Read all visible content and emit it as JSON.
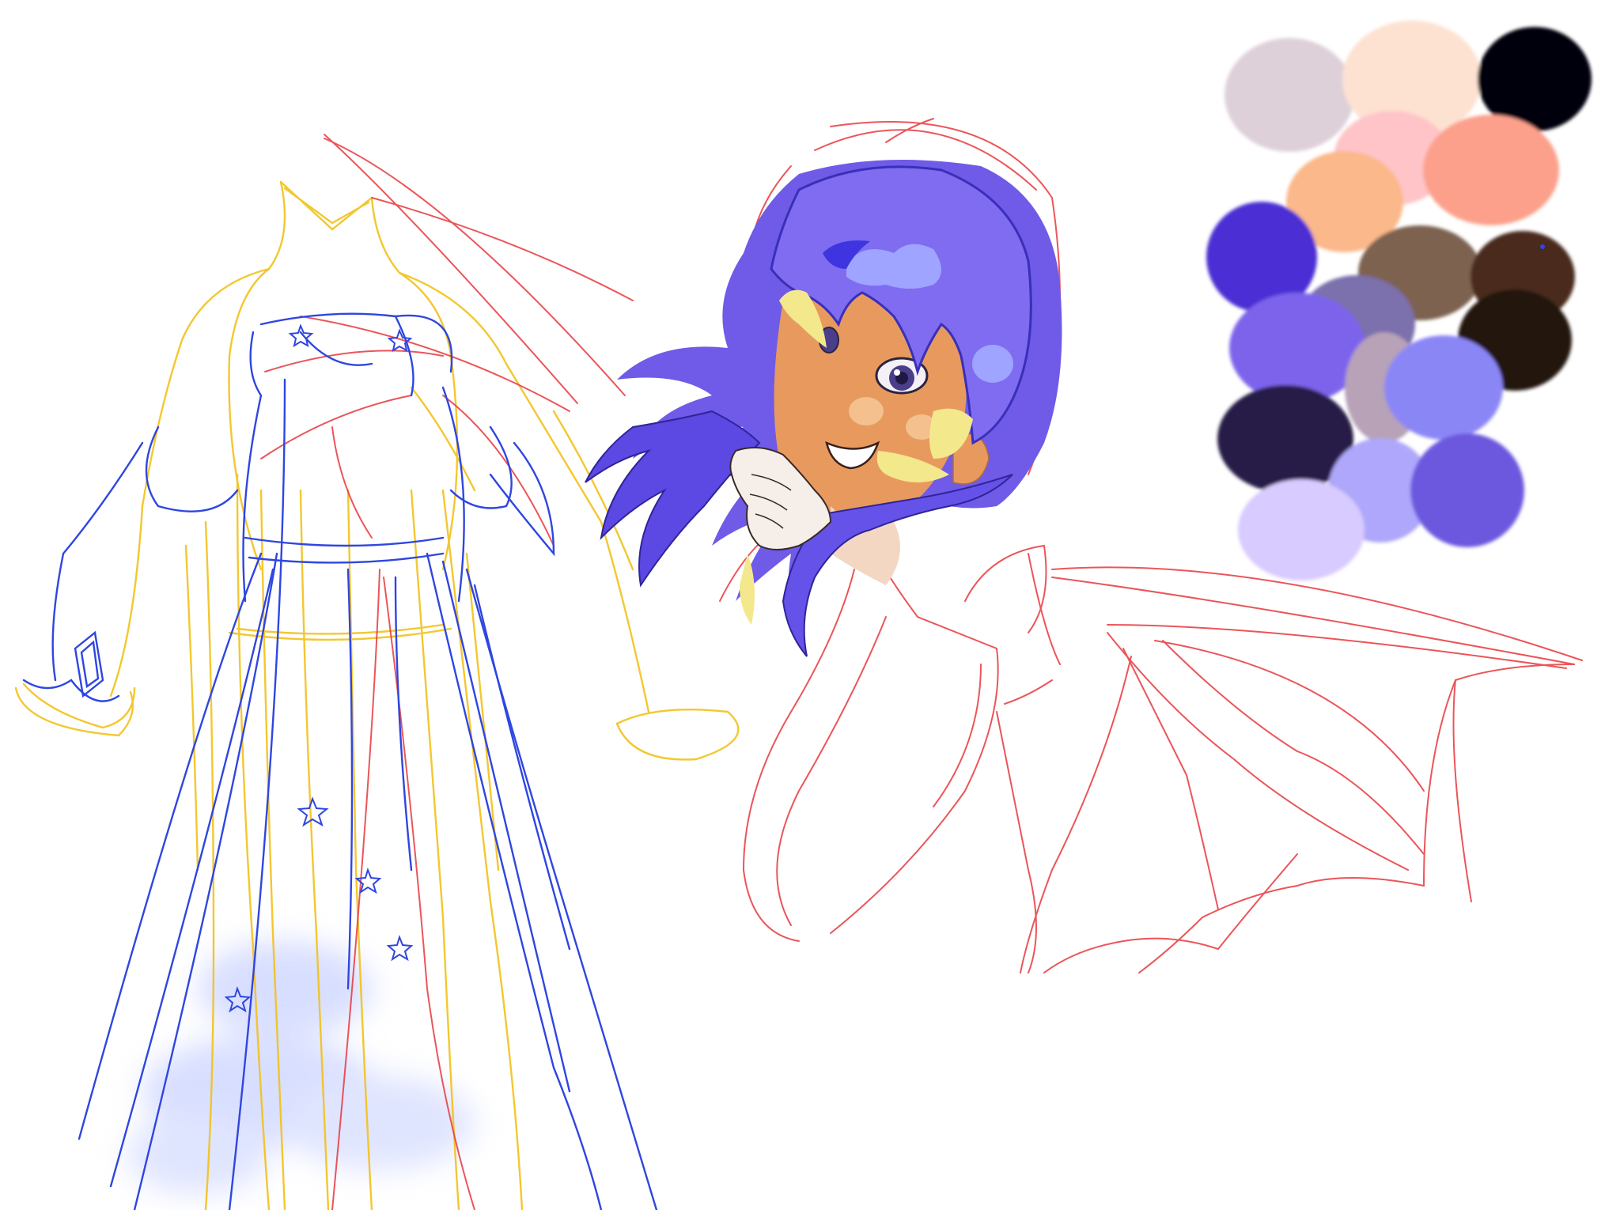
{
  "canvas": {
    "background": "#ffffff"
  },
  "colors": {
    "sketch_red": "#e8383d",
    "sketch_blue": "#2f46e0",
    "sketch_yellow": "#f2c21a",
    "hair_purple": "#7f6cf0",
    "hair_dark": "#4a35d6",
    "hair_highlight": "#9ea4ff",
    "skin_tan": "#e89a5e",
    "skin_light": "#f3c08e",
    "hair_streak_blonde": "#f4e88c",
    "skirt_glow": "#b9c4ff"
  },
  "palette": {
    "swatches": [
      "#ded0d9",
      "#fde2d2",
      "#050507",
      "#ffc4c8",
      "#fca08c",
      "#fbb88a",
      "#4b2fd4",
      "#7d6250",
      "#4a2c1e",
      "#7b70ad",
      "#7d63ec",
      "#221410",
      "#b7a2b8",
      "#8b86f6",
      "#281c47",
      "#aea7fb",
      "#6c58df",
      "#d8cbff"
    ]
  },
  "artwork": {
    "subjects": [
      "dress-sketch",
      "character-portrait",
      "bat-wing-sketch",
      "color-palette"
    ]
  }
}
